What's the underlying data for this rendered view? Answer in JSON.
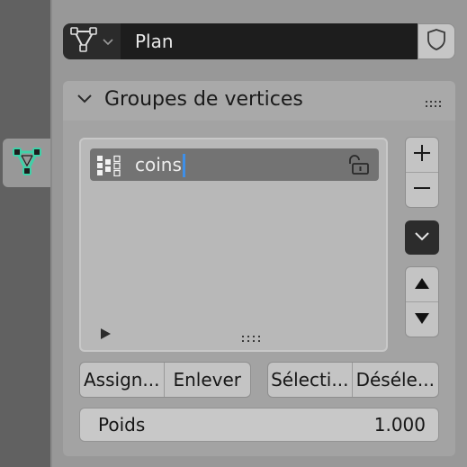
{
  "colors": {
    "accent": "#3e8fe8",
    "mesh_icon": "#3fd1a8"
  },
  "header": {
    "object_name": "Plan"
  },
  "panel": {
    "title": "Groupes de vertices"
  },
  "vertex_groups": [
    {
      "label": "coins"
    }
  ],
  "buttons": {
    "assign": "Assign...",
    "remove": "Enlever",
    "select": "Sélecti...",
    "deselect": "Déséle..."
  },
  "weight": {
    "label": "Poids",
    "value": "1.000"
  },
  "icons": {
    "tab": "mesh-data-icon",
    "header": "mesh-data-icon",
    "fake_user": "shield-icon",
    "lock": "unlock-icon",
    "group": "vertex-group-icon"
  }
}
